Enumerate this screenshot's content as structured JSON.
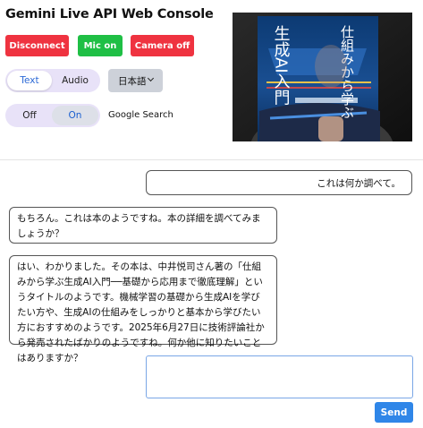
{
  "app": {
    "title": "Gemini Live API Web Console"
  },
  "controls": {
    "disconnect_label": "Disconnect",
    "mic_label": "Mic on",
    "camera_label": "Camera off"
  },
  "mode_toggle": {
    "options": [
      "Text",
      "Audio"
    ],
    "selected": "Text"
  },
  "language_select": {
    "value": "日本語"
  },
  "search_toggle": {
    "options": [
      "Off",
      "On"
    ],
    "selected": "On",
    "label": "Google Search"
  },
  "video_preview": {
    "book_title_vertical_1": "仕組みから学ぶ",
    "book_title_vertical_2": "生成AI入門"
  },
  "chat": {
    "messages": [
      {
        "role": "user",
        "text": "これは何か調べて。"
      },
      {
        "role": "model",
        "text": "もちろん。これは本のようですね。本の詳細を調べてみましょうか？"
      },
      {
        "role": "model",
        "text": "はい、わかりました。その本は、中井悦司さん著の「仕組みから学ぶ生成AI入門──基礎から応用まで徹底理解」というタイトルのようです。機械学習の基礎から生成AIを学びたい方や、生成AIの仕組みをしっかりと基本から学びたい方におすすめのようです。2025年6月27日に技術評論社から発売されたばかりのようですね。何か他に知りたいことはありますか？"
      }
    ]
  },
  "composer": {
    "value": "",
    "send_label": "Send"
  },
  "colors": {
    "red": "#ef3340",
    "green": "#1fbf45",
    "send": "#2f86e8",
    "pill": "#e8e2f8"
  }
}
